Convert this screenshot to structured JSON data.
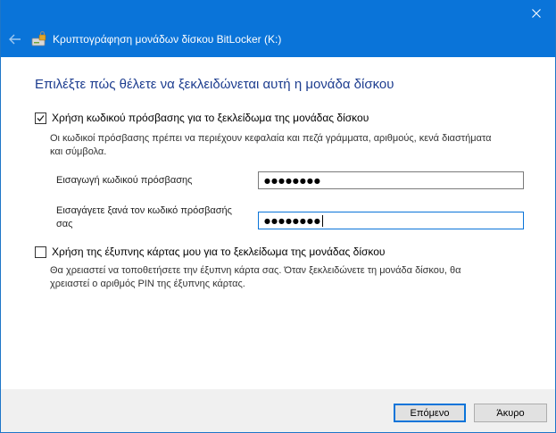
{
  "window": {
    "title": "Κρυπτογράφηση μονάδων δίσκου BitLocker (K:)",
    "back_icon": "back-arrow-icon",
    "close_icon": "close-icon",
    "app_icon": "bitlocker-drive-icon",
    "titlebar_color": "#0a74d9"
  },
  "main": {
    "heading": "Επιλέξτε πώς θέλετε να ξεκλειδώνεται αυτή η μονάδα δίσκου",
    "password_option": {
      "label": "Χρήση κωδικού πρόσβασης για το ξεκλείδωμα της μονάδας δίσκου",
      "checked": true,
      "description": "Οι κωδικοί πρόσβασης πρέπει να περιέχουν κεφαλαία και πεζά γράμματα, αριθμούς, κενά διαστήματα και σύμβολα.",
      "enter_label": "Εισαγωγή κωδικού πρόσβασης",
      "enter_value": "●●●●●●●●",
      "reenter_label": "Εισαγάγετε ξανά τον κωδικό πρόσβασής σας",
      "reenter_value": "●●●●●●●●"
    },
    "smartcard_option": {
      "label": "Χρήση της έξυπνης κάρτας μου για το ξεκλείδωμα της μονάδας δίσκου",
      "checked": false,
      "description": "Θα χρειαστεί να τοποθετήσετε την έξυπνη κάρτα σας. Όταν ξεκλειδώνετε τη μονάδα δίσκου, θα χρειαστεί ο αριθμός PIN της έξυπνης κάρτας."
    }
  },
  "footer": {
    "next_label": "Επόμενο",
    "cancel_label": "Άκυρο"
  }
}
